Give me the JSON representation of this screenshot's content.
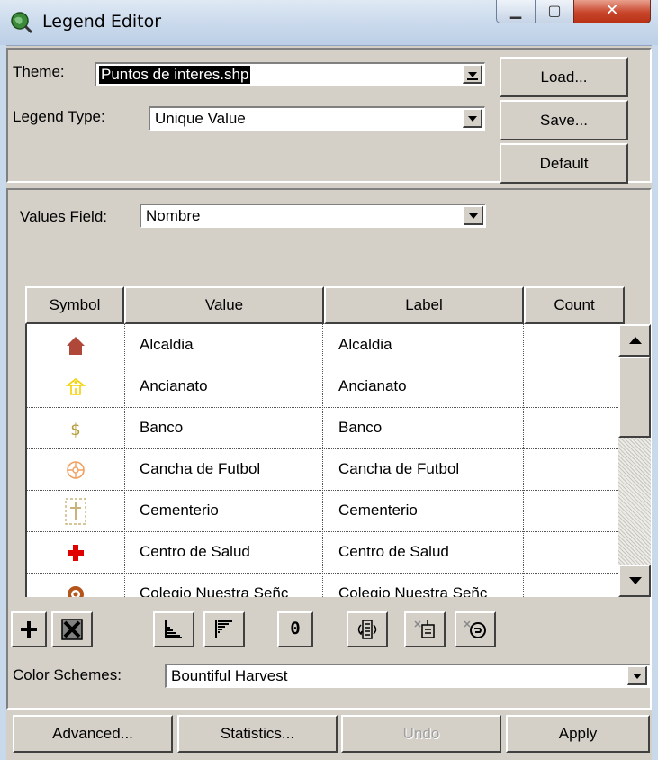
{
  "window": {
    "title": "Legend Editor"
  },
  "theme": {
    "label": "Theme:",
    "value": "Puntos de interes.shp"
  },
  "legend_type": {
    "label": "Legend Type:",
    "value": "Unique Value"
  },
  "buttons": {
    "load": "Load...",
    "save": "Save...",
    "default": "Default"
  },
  "values_field": {
    "label": "Values Field:",
    "value": "Nombre"
  },
  "table": {
    "headers": [
      "Symbol",
      "Value",
      "Label",
      "Count"
    ],
    "rows": [
      {
        "symbol": "house-icon",
        "value": "Alcaldia",
        "label": "Alcaldia",
        "count": ""
      },
      {
        "symbol": "elderly-home-icon",
        "value": "Ancianato",
        "label": "Ancianato",
        "count": ""
      },
      {
        "symbol": "dollar-icon",
        "value": "Banco",
        "label": "Banco",
        "count": ""
      },
      {
        "symbol": "soccer-field-icon",
        "value": "Cancha de Futbol",
        "label": "Cancha de Futbol",
        "count": ""
      },
      {
        "symbol": "cemetery-cross-icon",
        "value": "Cementerio",
        "label": "Cementerio",
        "count": ""
      },
      {
        "symbol": "red-cross-icon",
        "value": "Centro de Salud",
        "label": "Centro de Salud",
        "count": ""
      },
      {
        "symbol": "school-ring-icon",
        "value": "Colegio Nuestra Señc",
        "label": "Colegio Nuestra Señc",
        "count": ""
      }
    ]
  },
  "toolbar": {
    "zero_label": "0"
  },
  "color_schemes": {
    "label": "Color Schemes:",
    "value": "Bountiful Harvest"
  },
  "footer": {
    "advanced": "Advanced...",
    "statistics": "Statistics...",
    "undo": "Undo",
    "apply": "Apply"
  },
  "colors": {
    "house": "#b0483a",
    "elderly": "#f5d000",
    "dollar": "#b79b3a",
    "soccer": "#f0a060",
    "cemetery": "#c9b37a",
    "redcross": "#e00000",
    "school": "#b5551c"
  }
}
